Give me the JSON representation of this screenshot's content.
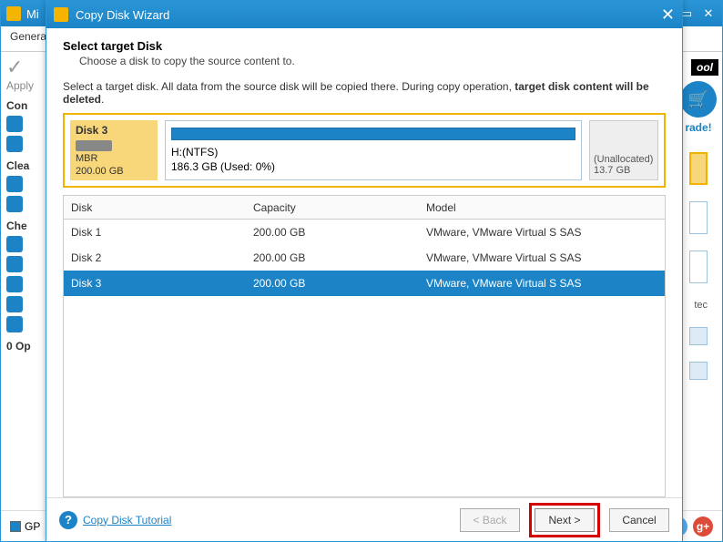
{
  "background": {
    "title": "Mi",
    "toolbar_label": "Genera",
    "apply_label": "Apply",
    "sections": {
      "convert": "Con",
      "clean": "Clea",
      "check": "Che"
    },
    "ops": "0 Op",
    "gp_label": "GP",
    "brand_partial": "ool",
    "upgrade_label": "rade!",
    "ted_partial": "tec"
  },
  "wizard": {
    "title": "Copy Disk Wizard",
    "heading": "Select target Disk",
    "subheading": "Choose a disk to copy the source content to.",
    "info_prefix": "Select a target disk. All data from the source disk will be copied there. During copy operation, ",
    "info_bold": "target disk content will be deleted",
    "info_suffix": ".",
    "selected_disk": {
      "name": "Disk 3",
      "type": "MBR",
      "size": "200.00 GB",
      "partition_label": "H:(NTFS)",
      "partition_size": "186.3 GB (Used: 0%)",
      "unalloc_label": "(Unallocated)",
      "unalloc_size": "13.7 GB"
    },
    "columns": {
      "disk": "Disk",
      "capacity": "Capacity",
      "model": "Model"
    },
    "rows": [
      {
        "disk": "Disk 1",
        "capacity": "200.00 GB",
        "model": "VMware, VMware Virtual S SAS",
        "selected": false
      },
      {
        "disk": "Disk 2",
        "capacity": "200.00 GB",
        "model": "VMware, VMware Virtual S SAS",
        "selected": false
      },
      {
        "disk": "Disk 3",
        "capacity": "200.00 GB",
        "model": "VMware, VMware Virtual S SAS",
        "selected": true
      }
    ],
    "help_link": "Copy Disk Tutorial",
    "buttons": {
      "back": "< Back",
      "next": "Next >",
      "cancel": "Cancel"
    }
  }
}
